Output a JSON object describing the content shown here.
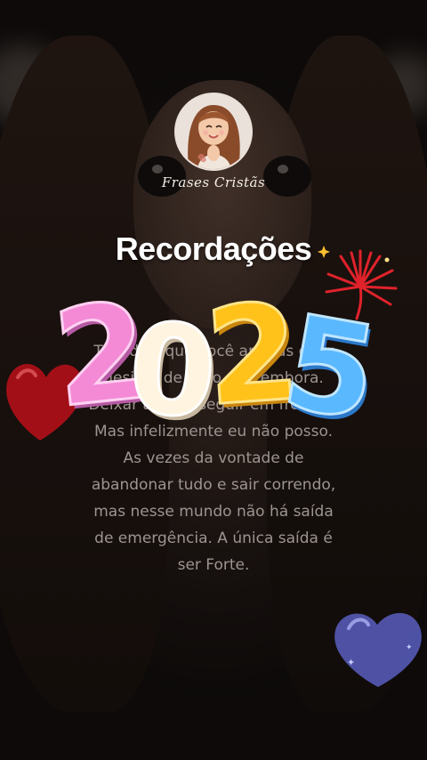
{
  "brand": {
    "name": "Frases Cristãs"
  },
  "title": "Recordações",
  "year": "2025",
  "quote": {
    "lines": [
      "Tem dias que você apenas quer",
      "desistir de tudo, e ir embora.",
      "Deixar a vida, seguir em frente...",
      "Mas infelizmente eu não posso.",
      "As vezes da vontade de",
      "abandonar tudo e sair correndo,",
      "mas nesse mundo não há saída",
      "de emergência. A única saída é",
      "ser Forte."
    ]
  },
  "colors": {
    "year_2_first": "#f48ad6",
    "year_0": "#fff4df",
    "year_2_second": "#ffc21b",
    "year_5": "#5ab8ff",
    "heart_left": "#b5121b",
    "heart_right": "#6a6fd8",
    "firework": "#e0222b"
  },
  "icons": [
    "avatar-illustration",
    "red-heart-icon",
    "blue-heart-icon",
    "firework-icon",
    "sparkle-icon"
  ]
}
